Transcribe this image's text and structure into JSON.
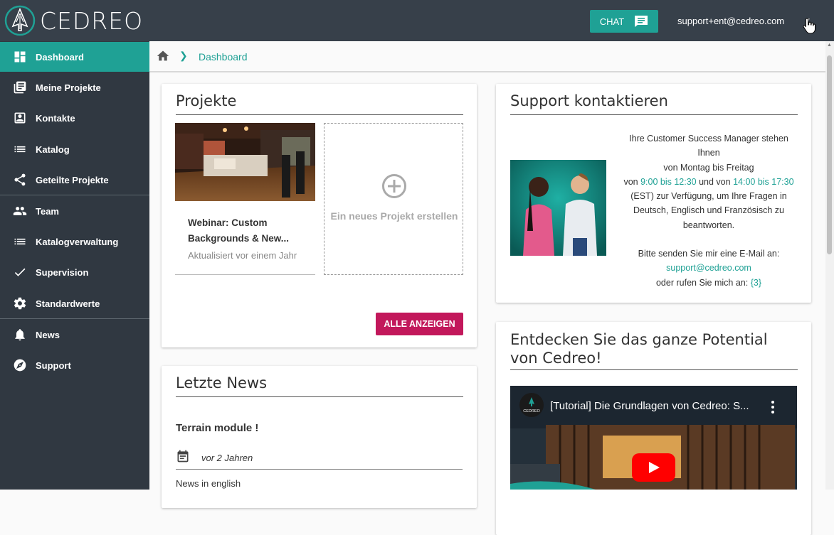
{
  "header": {
    "logo_text": "CEDREO",
    "chat_label": "CHAT",
    "user_email": "support+ent@cedreo.com"
  },
  "sidebar": {
    "items": [
      {
        "label": "Dashboard",
        "icon": "dashboard-icon"
      },
      {
        "label": "Meine Projekte",
        "icon": "projects-icon"
      },
      {
        "label": "Kontakte",
        "icon": "contact-icon"
      },
      {
        "label": "Katalog",
        "icon": "list-icon"
      },
      {
        "label": "Geteilte Projekte",
        "icon": "share-icon"
      },
      {
        "label": "Team",
        "icon": "people-icon"
      },
      {
        "label": "Katalogverwaltung",
        "icon": "list-icon"
      },
      {
        "label": "Supervision",
        "icon": "check-icon"
      },
      {
        "label": "Standardwerte",
        "icon": "gear-icon"
      },
      {
        "label": "News",
        "icon": "bell-icon"
      },
      {
        "label": "Support",
        "icon": "compass-icon"
      }
    ]
  },
  "breadcrumb": {
    "current": "Dashboard"
  },
  "projects": {
    "title": "Projekte",
    "project_name": "Webinar: Custom Backgrounds & New...",
    "project_updated": "Aktualisiert vor einem Jahr",
    "new_project_label": "Ein neues Projekt erstellen",
    "show_all_label": "ALLE ANZEIGEN"
  },
  "news": {
    "title": "Letzte News",
    "item_title": "Terrain module !",
    "item_date": "vor 2 Jahren",
    "item_body": "News in english"
  },
  "support": {
    "title": "Support kontaktieren",
    "line1": "Ihre Customer Success Manager stehen Ihnen",
    "line2": "von Montag bis Freitag",
    "line3_a": "von ",
    "time1": "9:00 bis 12:30",
    "line3_b": " und von ",
    "time2": "14:00 bis 17:30",
    "line3_c": " (EST) zur Verfügung, um Ihre Fragen in Deutsch, Englisch und Französisch zu beantworten.",
    "line4": "Bitte senden Sie mir eine E-Mail an:",
    "email": "support@cedreo.com",
    "line5": "oder rufen Sie mich an: ",
    "phone": "{3}"
  },
  "discover": {
    "title": "Entdecken Sie das ganze Potential von Cedreo!",
    "video_title": "[Tutorial] Die Grundlagen von Cedreo: S...",
    "video_logo_text": "CEDREO"
  },
  "colors": {
    "accent": "#1fa195",
    "sidebar": "#303841",
    "topbar": "#37404a",
    "cta": "#c2185b"
  }
}
